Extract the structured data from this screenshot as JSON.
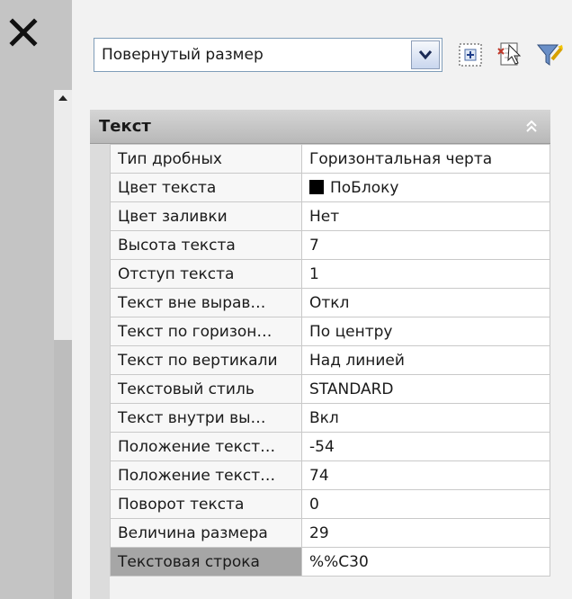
{
  "palette": {
    "sidebar": "#c4c4c4",
    "header": "#bdbdbd",
    "selected_row": "#a6a6a6",
    "swatch": "#000000"
  },
  "icons": {
    "close": "close-icon",
    "scroll_up": "chevron-up-icon",
    "dropdown": "chevron-down-icon",
    "select_objects": "select-objects-icon",
    "quick_select": "quick-select-icon",
    "pickadd": "pickadd-icon",
    "collapse": "double-chevron-up-icon"
  },
  "selector": {
    "value": "Повернутый размер"
  },
  "section": {
    "title": "Текст"
  },
  "properties": [
    {
      "name": "Тип дробных",
      "value": "Горизонтальная черта"
    },
    {
      "name": "Цвет текста",
      "value": "ПоБлоку",
      "swatch": true
    },
    {
      "name": "Цвет заливки",
      "value": "Нет"
    },
    {
      "name": "Высота текста",
      "value": "7"
    },
    {
      "name": "Отступ текста",
      "value": "1"
    },
    {
      "name": "Текст вне вырав…",
      "value": "Откл"
    },
    {
      "name": "Текст по горизон…",
      "value": "По центру"
    },
    {
      "name": "Текст по вертикали",
      "value": "Над линией"
    },
    {
      "name": "Текстовый стиль",
      "value": "STANDARD"
    },
    {
      "name": "Текст внутри вы…",
      "value": "Вкл"
    },
    {
      "name": "Положение текст…",
      "value": "-54"
    },
    {
      "name": "Положение текст…",
      "value": "74"
    },
    {
      "name": "Поворот текста",
      "value": "0"
    },
    {
      "name": "Величина размера",
      "value": "29"
    },
    {
      "name": "Текстовая строка",
      "value": "%%C30",
      "selected": true
    }
  ]
}
